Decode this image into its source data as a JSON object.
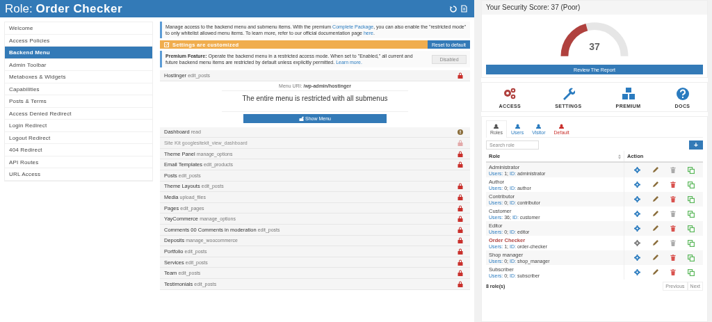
{
  "header": {
    "prefix": "Role:",
    "name": "Order Checker"
  },
  "sidebar": {
    "items": [
      {
        "label": "Welcome",
        "selected": false
      },
      {
        "label": "Access Policies",
        "selected": false
      },
      {
        "label": "Backend Menu",
        "selected": true
      },
      {
        "label": "Admin Toolbar",
        "selected": false
      },
      {
        "label": "Metaboxes & Widgets",
        "selected": false
      },
      {
        "label": "Capabilities",
        "selected": false
      },
      {
        "label": "Posts & Terms",
        "selected": false
      },
      {
        "label": "Access Denied Redirect",
        "selected": false
      },
      {
        "label": "Login Redirect",
        "selected": false
      },
      {
        "label": "Logout Redirect",
        "selected": false
      },
      {
        "label": "404 Redirect",
        "selected": false
      },
      {
        "label": "API Routes",
        "selected": false
      },
      {
        "label": "URL Access",
        "selected": false
      }
    ]
  },
  "notice": {
    "parts": [
      {
        "kind": "text",
        "text": "Manage access to the backend menu and submenu items. With the premium "
      },
      {
        "kind": "link",
        "text": "Complete Package"
      },
      {
        "kind": "text",
        "text": ", you can also enable the \"restricted mode\" to only whitelist allowed menu items. To learn more, refer to our official documentation page "
      },
      {
        "kind": "link",
        "text": "here"
      },
      {
        "kind": "text",
        "text": "."
      }
    ]
  },
  "customized": {
    "label": "Settings are customized",
    "button": "Reset to default"
  },
  "premium": {
    "parts": [
      {
        "kind": "bold",
        "text": "Premium Feature:"
      },
      {
        "kind": "text",
        "text": " Operate the backend menu in a restricted access mode. When set to \"Enabled,\" all current and future backend menu items are restricted by default unless explicitly permitted. "
      },
      {
        "kind": "link",
        "text": "Learn more."
      }
    ],
    "toggle": {
      "label": "Disabled",
      "disabled": true
    }
  },
  "expanded_item": {
    "name": "Hostinger",
    "capability": "edit_posts",
    "locked": true,
    "uri_label": "Menu URI:",
    "uri": "/wp-admin/hostinger",
    "message": "The entire menu is restricted with all submenus",
    "button": "Show Menu"
  },
  "menu_items": [
    {
      "name": "Dashboard",
      "capability": "read",
      "locked": false,
      "warning": true,
      "faded": false
    },
    {
      "name": "Site Kit",
      "capability": "googlesitekit_view_dashboard",
      "locked": true,
      "warning": false,
      "faded": true
    },
    {
      "name": "Theme Panel",
      "capability": "manage_options",
      "locked": true,
      "warning": false,
      "faded": false
    },
    {
      "name": "Email Templates",
      "capability": "edit_products",
      "locked": true,
      "warning": false,
      "faded": false
    },
    {
      "name": "Posts",
      "capability": "edit_posts",
      "locked": false,
      "warning": false,
      "faded": false
    },
    {
      "name": "Theme Layouts",
      "capability": "edit_posts",
      "locked": true,
      "warning": false,
      "faded": false
    },
    {
      "name": "Media",
      "capability": "upload_files",
      "locked": true,
      "warning": false,
      "faded": false
    },
    {
      "name": "Pages",
      "capability": "edit_pages",
      "locked": true,
      "warning": false,
      "faded": false
    },
    {
      "name": "YayCommerce",
      "capability": "manage_options",
      "locked": true,
      "warning": false,
      "faded": false
    },
    {
      "name": "Comments 00 Comments in moderation",
      "capability": "edit_posts",
      "locked": true,
      "warning": false,
      "faded": false
    },
    {
      "name": "Deposits",
      "capability": "manage_woocommerce",
      "locked": true,
      "warning": false,
      "faded": false
    },
    {
      "name": "Portfolio",
      "capability": "edit_posts",
      "locked": true,
      "warning": false,
      "faded": false
    },
    {
      "name": "Services",
      "capability": "edit_posts",
      "locked": true,
      "warning": false,
      "faded": false
    },
    {
      "name": "Team",
      "capability": "edit_posts",
      "locked": true,
      "warning": false,
      "faded": false
    },
    {
      "name": "Testimonials",
      "capability": "edit_posts",
      "locked": true,
      "warning": false,
      "faded": false
    }
  ],
  "score": {
    "title": "Your Security Score: 37 (Poor)",
    "level": 0.37,
    "value": "37",
    "button": "Review The Report"
  },
  "shortcuts": [
    {
      "kind": "access",
      "label": "ACCESS"
    },
    {
      "kind": "settings",
      "label": "SETTINGS"
    },
    {
      "kind": "premium",
      "label": "PREMIUM"
    },
    {
      "kind": "docs",
      "label": "DOCS"
    }
  ],
  "tabs": [
    {
      "kind": "roles",
      "label": "Roles",
      "selected": true
    },
    {
      "kind": "users",
      "label": "Users",
      "selected": false
    },
    {
      "kind": "visitor",
      "label": "Visitor",
      "selected": false
    },
    {
      "kind": "default",
      "label": "Default",
      "selected": false
    }
  ],
  "search": {
    "placeholder": "Search role"
  },
  "add_button": "+",
  "table": {
    "columns": [
      "Role",
      "Action"
    ],
    "rows": [
      {
        "name": "Administrator",
        "users_label": "Users:",
        "users": "1;",
        "id_label": "ID:",
        "id": "administrator",
        "current": false,
        "deletable": false
      },
      {
        "name": "Author",
        "users_label": "Users:",
        "users": "0;",
        "id_label": "ID:",
        "id": "author",
        "current": false,
        "deletable": true
      },
      {
        "name": "Contributor",
        "users_label": "Users:",
        "users": "0;",
        "id_label": "ID:",
        "id": "contributor",
        "current": false,
        "deletable": true
      },
      {
        "name": "Customer",
        "users_label": "Users:",
        "users": "36;",
        "id_label": "ID:",
        "id": "customer",
        "current": false,
        "deletable": false
      },
      {
        "name": "Editor",
        "users_label": "Users:",
        "users": "0;",
        "id_label": "ID:",
        "id": "editor",
        "current": false,
        "deletable": true
      },
      {
        "name": "Order Checker",
        "users_label": "Users:",
        "users": "1;",
        "id_label": "ID:",
        "id": "order-checker",
        "current": true,
        "deletable": false
      },
      {
        "name": "Shop manager",
        "users_label": "Users:",
        "users": "0;",
        "id_label": "ID:",
        "id": "shop_manager",
        "current": false,
        "deletable": true
      },
      {
        "name": "Subscriber",
        "users_label": "Users:",
        "users": "0;",
        "id_label": "ID:",
        "id": "subscriber",
        "current": false,
        "deletable": true
      }
    ]
  },
  "footer": {
    "count": "8 role(s)",
    "pages": [
      "Previous",
      "Next"
    ]
  }
}
